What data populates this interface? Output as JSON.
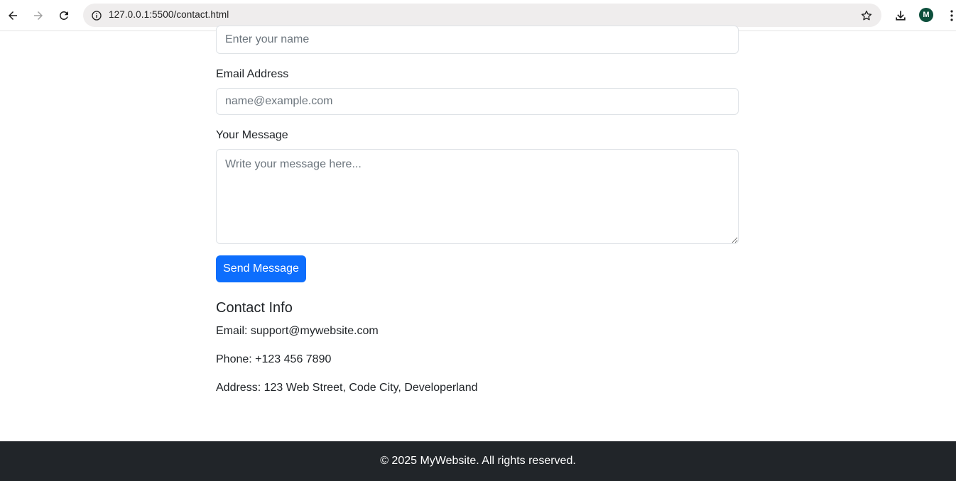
{
  "browser": {
    "url": "127.0.0.1:5500/contact.html",
    "avatar_initial": "M",
    "icons": {
      "back": "back-arrow-icon",
      "forward": "forward-arrow-icon",
      "reload": "reload-icon",
      "site_info": "info-circle-icon",
      "bookmark": "star-icon",
      "download": "download-icon",
      "menu": "kebab-menu-icon"
    }
  },
  "form": {
    "name_placeholder": "Enter your name",
    "email_label": "Email Address",
    "email_placeholder": "name@example.com",
    "message_label": "Your Message",
    "message_placeholder": "Write your message here...",
    "submit_label": "Send Message"
  },
  "contact_info": {
    "heading": "Contact Info",
    "email": "Email: support@mywebsite.com",
    "phone": "Phone: +123 456 7890",
    "address": "Address: 123 Web Street, Code City, Developerland"
  },
  "footer": {
    "text": "© 2025 MyWebsite. All rights reserved."
  },
  "colors": {
    "primary_button": "#0d6efd",
    "footer_background": "#212529",
    "avatar_background": "#0d4f3c"
  }
}
